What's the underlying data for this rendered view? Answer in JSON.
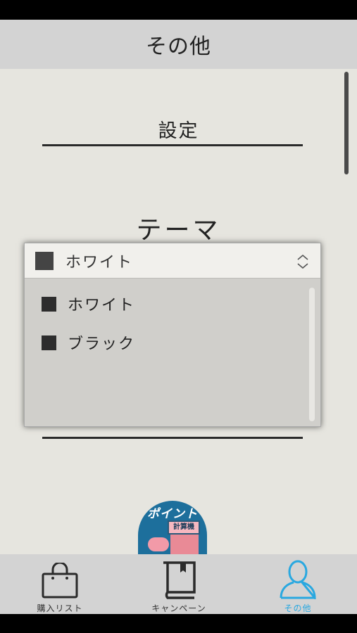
{
  "header": {
    "title": "その他"
  },
  "settings": {
    "title": "設定"
  },
  "theme": {
    "title": "テーマ",
    "selected": "ホワイト",
    "options": [
      "ホワイト",
      "ブラック"
    ]
  },
  "badge": {
    "text": "ポイント",
    "sub": "計算機"
  },
  "tabs": [
    {
      "label": "購入リスト",
      "icon": "shopping-bag-icon"
    },
    {
      "label": "キャンペーン",
      "icon": "book-icon"
    },
    {
      "label": "その他",
      "icon": "person-icon"
    }
  ],
  "colors": {
    "accent": "#29a8e0",
    "header": "#d3d3d3",
    "background": "#e6e5df"
  }
}
